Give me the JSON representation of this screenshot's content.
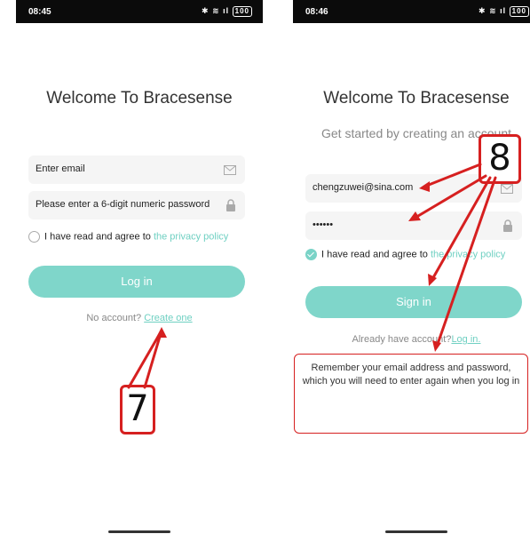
{
  "left": {
    "status": {
      "time": "08:45",
      "icons": "✱ ≋ ıl",
      "battery": "100"
    },
    "title": "Welcome To Bracesense",
    "email_placeholder": "Enter email",
    "password_placeholder": "Please enter a 6-digit numeric password",
    "agree_text": "I have read and agree to",
    "privacy_link": "the privacy policy",
    "login_button": "Log in",
    "no_account_text": "No account?",
    "create_link": "Create one",
    "step_badge": "7"
  },
  "right": {
    "status": {
      "time": "08:46",
      "icons": "✱ ≋ ıl",
      "battery": "100"
    },
    "title": "Welcome To Bracesense",
    "subtitle": "Get started by creating an account",
    "email_value": "chengzuwei@sina.com",
    "password_value": "••••••",
    "agree_text": "I have read and agree to",
    "privacy_link": "the privacy policy",
    "signin_button": "Sign in",
    "have_account_text": "Already have account?",
    "login_link": "Log in.",
    "note": "Remember your email address and password, which you will need to enter again when you log in",
    "step_badge": "8"
  },
  "colors": {
    "accent": "#7fd6ca",
    "annotation": "#d62020"
  }
}
